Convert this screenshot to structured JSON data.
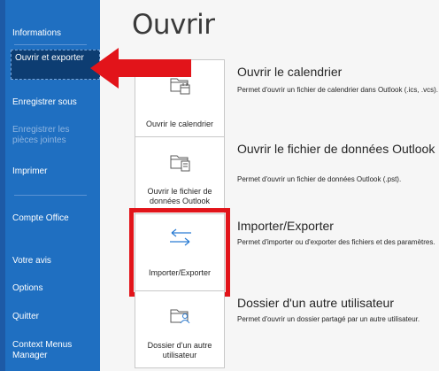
{
  "sidebar": {
    "items": [
      {
        "label": "Informations",
        "disabled": false
      },
      {
        "label": "Ouvrir et exporter",
        "disabled": false,
        "selected": true
      },
      {
        "label": "Enregistrer sous",
        "disabled": false
      },
      {
        "label": "Enregistrer les pièces jointes",
        "disabled": true
      },
      {
        "label": "Imprimer",
        "disabled": false
      },
      {
        "label": "Compte Office",
        "disabled": false
      },
      {
        "label": "Votre avis",
        "disabled": false
      },
      {
        "label": "Options",
        "disabled": false
      },
      {
        "label": "Quitter",
        "disabled": false
      },
      {
        "label": "Context Menus Manager",
        "disabled": false
      }
    ]
  },
  "main": {
    "title": "Ouvrir",
    "options": [
      {
        "tile_label": "Ouvrir le calendrier",
        "title": "Ouvrir le calendrier",
        "description": "Permet d'ouvrir un fichier de calendrier dans Outlook (.ics, .vcs).",
        "icon": "open-calendar-icon"
      },
      {
        "tile_label": "Ouvrir le fichier de données Outlook",
        "title": "Ouvrir le fichier de données Outlook",
        "description": "Permet d'ouvrir un fichier de données Outlook (.pst).",
        "icon": "open-data-file-icon"
      },
      {
        "tile_label": "Importer/Exporter",
        "title": "Importer/Exporter",
        "description": "Permet d'importer ou d'exporter des fichiers et des paramètres.",
        "icon": "import-export-arrows-icon",
        "highlighted": true
      },
      {
        "tile_label": "Dossier d'un autre utilisateur",
        "title": "Dossier d'un autre utilisateur",
        "description": "Permet d'ouvrir un dossier partagé par un autre utilisateur.",
        "icon": "shared-folder-user-icon"
      }
    ]
  },
  "annotations": {
    "arrow_color": "#e2141a",
    "highlight_color": "#e2141a"
  },
  "colors": {
    "sidebar_bg": "#1f6fc1",
    "sidebar_selected_bg": "#0d3d72",
    "accent_blue": "#2b7cd3"
  }
}
